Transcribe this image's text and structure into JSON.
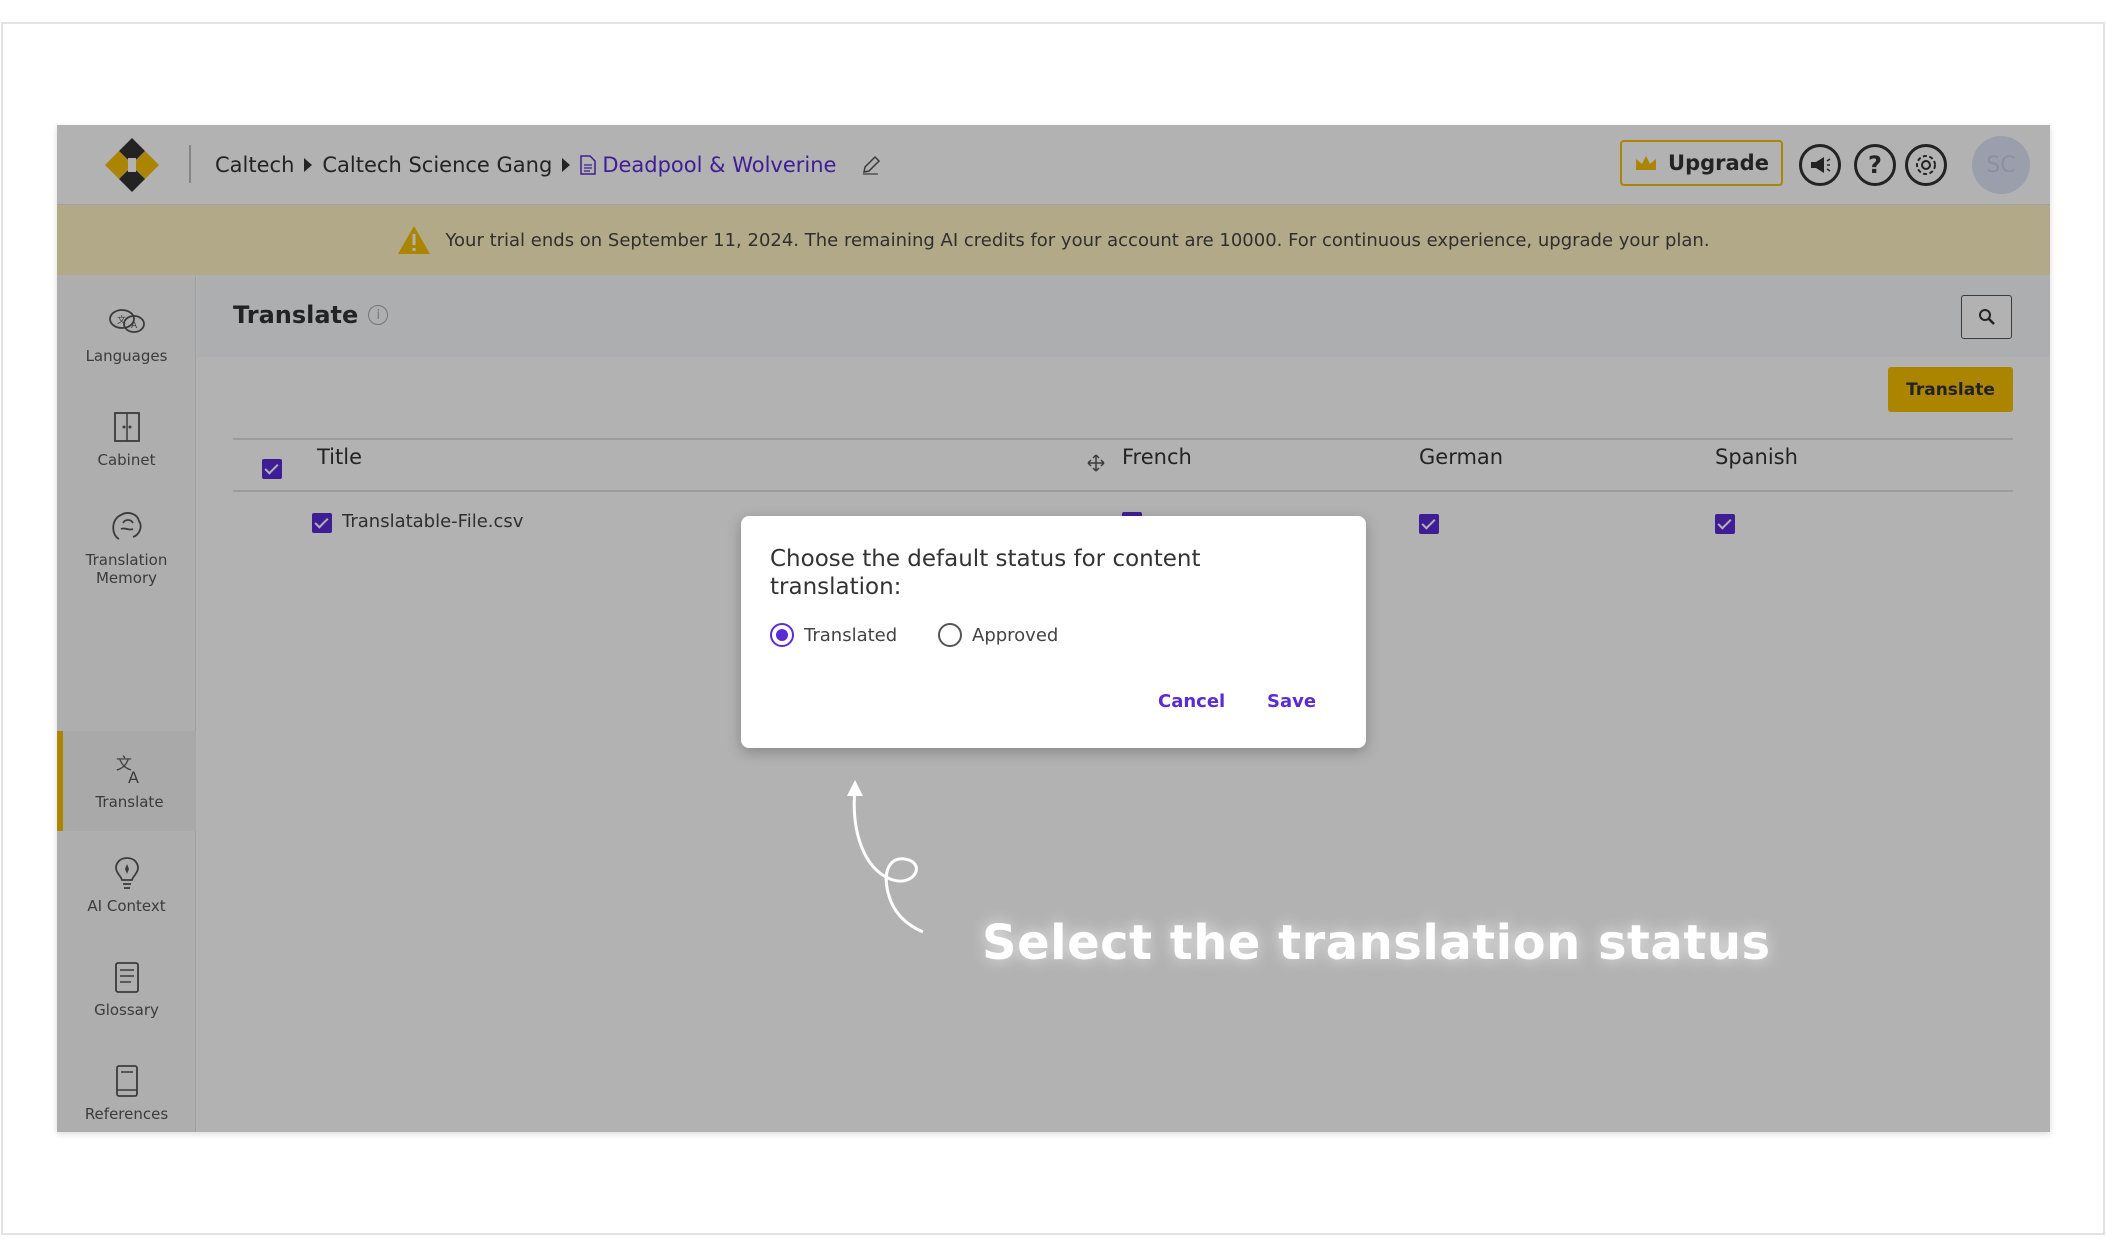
{
  "header": {
    "breadcrumbs": [
      "Caltech",
      "Caltech Science Gang"
    ],
    "document": "Deadpool & Wolverine",
    "upgrade_label": "Upgrade",
    "avatar_initials": "SC"
  },
  "banner": {
    "text": "Your trial ends on September 11, 2024. The remaining AI credits for your account are 10000. For continuous experience, upgrade your plan."
  },
  "sidebar": {
    "items": [
      {
        "label": "Languages",
        "icon": "languages-icon"
      },
      {
        "label": "Cabinet",
        "icon": "cabinet-icon"
      },
      {
        "label": "Translation Memory",
        "icon": "translation-memory-icon"
      },
      {
        "label": "Translate",
        "icon": "translate-icon",
        "active": true
      },
      {
        "label": "AI Context",
        "icon": "ai-context-icon"
      },
      {
        "label": "Glossary",
        "icon": "glossary-icon"
      },
      {
        "label": "References",
        "icon": "references-icon"
      }
    ]
  },
  "main": {
    "title": "Translate",
    "translate_button": "Translate",
    "columns": [
      "Title",
      "French",
      "German",
      "Spanish"
    ],
    "rows": [
      {
        "title": "Translatable-File.csv",
        "french": true,
        "german": true,
        "spanish": true
      }
    ]
  },
  "dialog": {
    "title": "Choose the default status for content translation:",
    "options": [
      "Translated",
      "Approved"
    ],
    "selected": "Translated",
    "cancel_label": "Cancel",
    "save_label": "Save"
  },
  "annotation": {
    "text": "Select the translation status"
  },
  "colors": {
    "accent": "#5b2bd6",
    "brand_yellow": "#f5bd00",
    "banner_bg": "#fff3c4"
  }
}
